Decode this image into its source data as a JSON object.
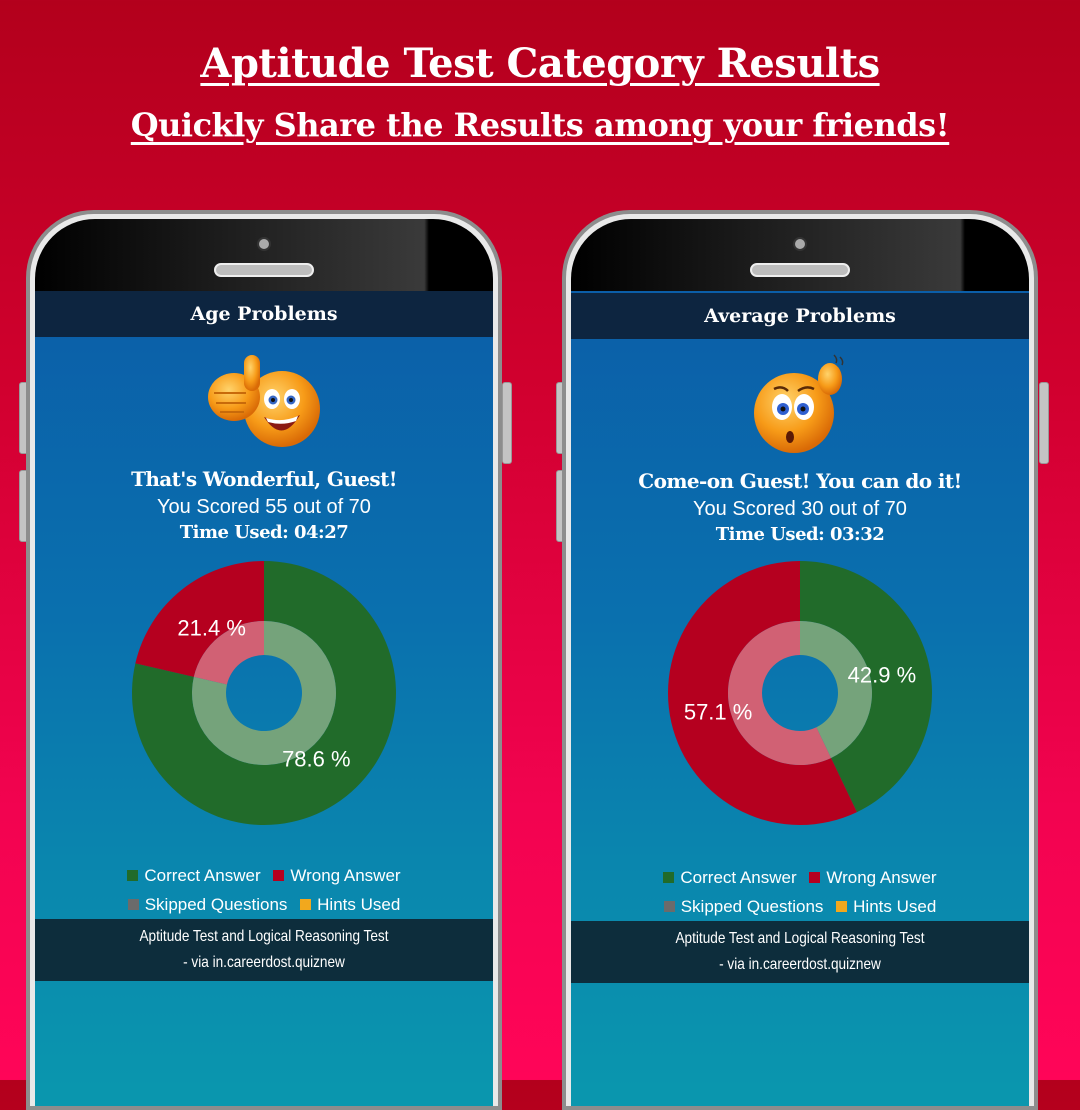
{
  "header": {
    "title": "Aptitude Test Category Results",
    "subtitle": "Quickly Share the Results among your friends!"
  },
  "legend": {
    "correct": {
      "label": "Correct Answer",
      "color": "#216b2a"
    },
    "wrong": {
      "label": "Wrong Answer",
      "color": "#b5001f"
    },
    "skipped": {
      "label": "Skipped Questions",
      "color": "#6b6b6b"
    },
    "hints": {
      "label": "Hints Used",
      "color": "#f2a81d"
    }
  },
  "phones": [
    {
      "category": "Age Problems",
      "emoji": "thumbs-up-emoji",
      "message": "That's Wonderful, Guest!",
      "score_text": "You Scored 55 out of 70",
      "time_text": "Time Used: 04:27",
      "footer_line1": "Aptitude Test and Logical Reasoning Test",
      "footer_line2": "- via in.careerdost.quiznew"
    },
    {
      "category": "Average Problems",
      "emoji": "confused-thinking-emoji",
      "message": "Come-on Guest! You can do it!",
      "score_text": "You Scored 30 out of 70",
      "time_text": "Time Used: 03:32",
      "footer_line1": "Aptitude Test and Logical Reasoning Test",
      "footer_line2": "- via in.careerdost.quiznew"
    }
  ],
  "chart_data": [
    {
      "type": "pie",
      "title": "Age Problems",
      "categories": [
        "Correct Answer",
        "Wrong Answer"
      ],
      "values": [
        78.6,
        21.4
      ],
      "labels": [
        "78.6 %",
        "21.4 %"
      ],
      "colors": [
        "#216b2a",
        "#b5001f"
      ],
      "legend": [
        "Correct Answer",
        "Wrong Answer",
        "Skipped Questions",
        "Hints Used"
      ],
      "legend_position": "bottom"
    },
    {
      "type": "pie",
      "title": "Average Problems",
      "categories": [
        "Correct Answer",
        "Wrong Answer"
      ],
      "values": [
        42.9,
        57.1
      ],
      "labels": [
        "42.9 %",
        "57.1 %"
      ],
      "colors": [
        "#216b2a",
        "#b5001f"
      ],
      "legend": [
        "Correct Answer",
        "Wrong Answer",
        "Skipped Questions",
        "Hints Used"
      ],
      "legend_position": "bottom"
    }
  ]
}
